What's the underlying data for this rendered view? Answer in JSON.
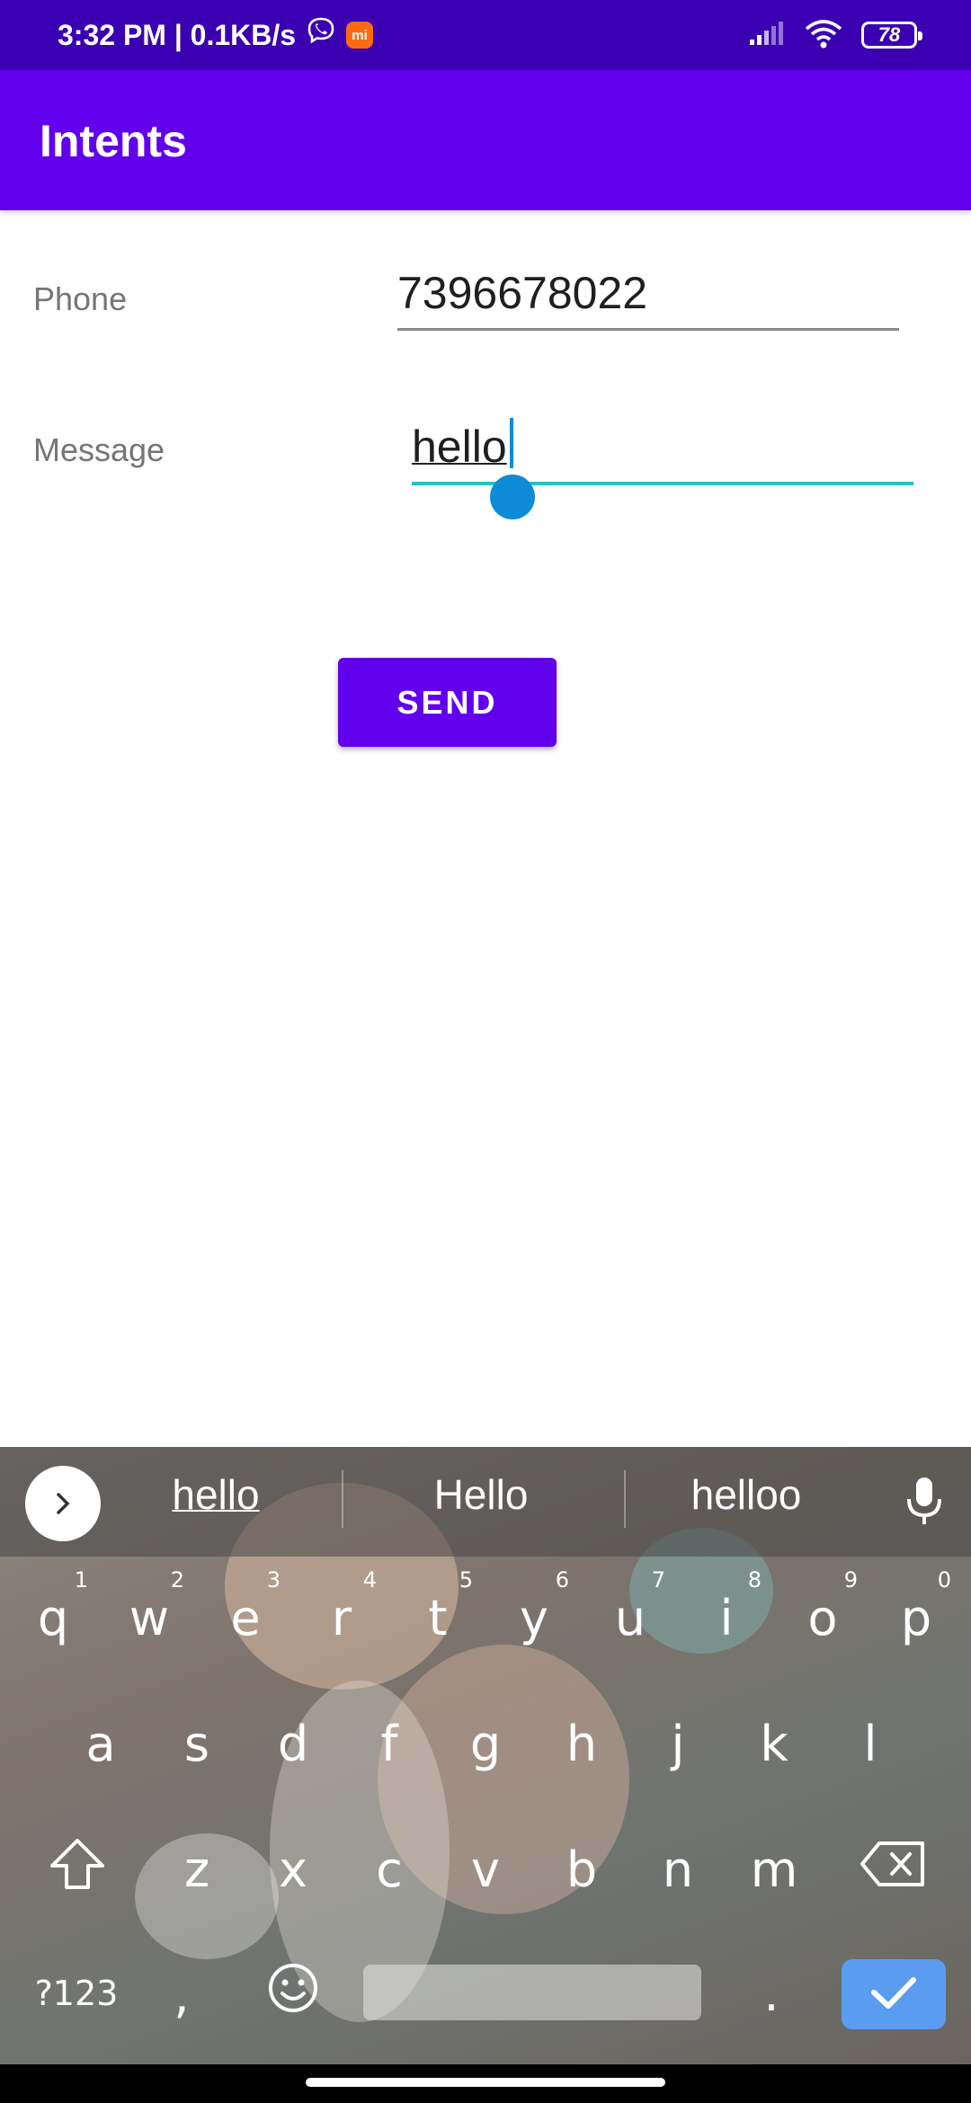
{
  "status_bar": {
    "time_and_speed": "3:32 PM | 0.1KB/s",
    "mi_icon_text": "mi",
    "battery": "78",
    "bg_color": "#3a00b2"
  },
  "app_bar": {
    "title": "Intents",
    "color": "#6200ee"
  },
  "form": {
    "phone_label": "Phone",
    "phone_value": "7396678022",
    "message_label": "Message",
    "message_value": "hello",
    "send_label": "SEND",
    "focus_color": "#1fc6bd"
  },
  "keyboard": {
    "suggestions": [
      "hello",
      "Hello",
      "helloo"
    ],
    "row1": [
      {
        "key": "q",
        "hint": "1"
      },
      {
        "key": "w",
        "hint": "2"
      },
      {
        "key": "e",
        "hint": "3"
      },
      {
        "key": "r",
        "hint": "4"
      },
      {
        "key": "t",
        "hint": "5"
      },
      {
        "key": "y",
        "hint": "6"
      },
      {
        "key": "u",
        "hint": "7"
      },
      {
        "key": "i",
        "hint": "8"
      },
      {
        "key": "o",
        "hint": "9"
      },
      {
        "key": "p",
        "hint": "0"
      }
    ],
    "row2": [
      "a",
      "s",
      "d",
      "f",
      "g",
      "h",
      "j",
      "k",
      "l"
    ],
    "row3": [
      "z",
      "x",
      "c",
      "v",
      "b",
      "n",
      "m"
    ],
    "symbols_label": "?123",
    "comma_label": ",",
    "period_label": ".",
    "enter_color": "#5a9cf0"
  }
}
